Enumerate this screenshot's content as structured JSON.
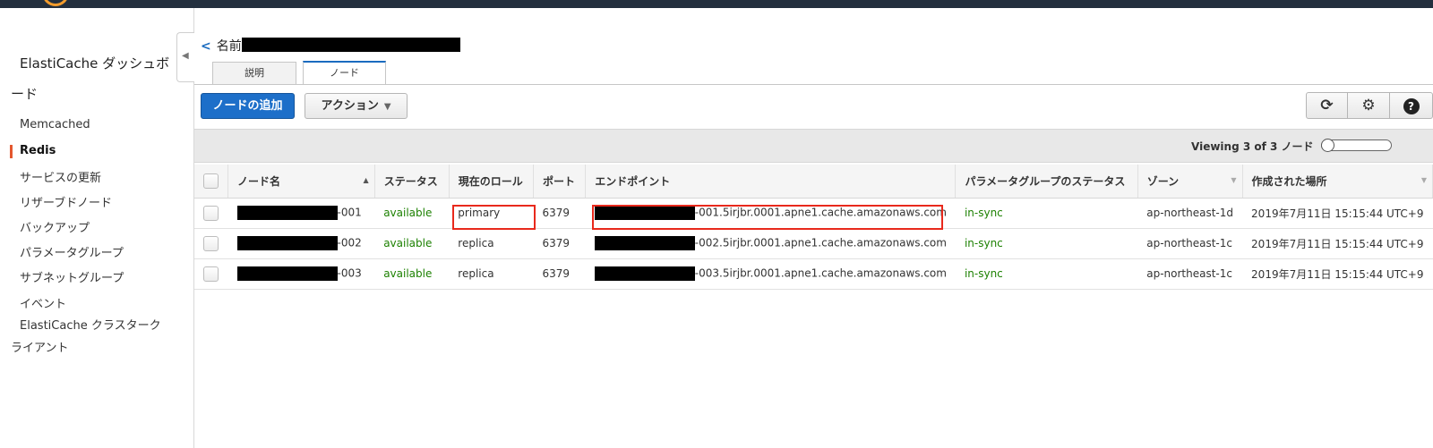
{
  "sidebar": {
    "title": "ElastiCache ダッシュボード",
    "items": [
      {
        "label": "Memcached"
      },
      {
        "label": "Redis"
      },
      {
        "label": "サービスの更新"
      },
      {
        "label": "リザーブドノード"
      },
      {
        "label": "バックアップ"
      },
      {
        "label": "パラメータグループ"
      },
      {
        "label": "サブネットグループ"
      },
      {
        "label": "イベント"
      },
      {
        "label": "ElastiCache クラスタークライアント"
      }
    ],
    "active_item": "Redis"
  },
  "breadcrumb": {
    "back": "<",
    "label": "名前:"
  },
  "tabs": [
    {
      "label": "説明"
    },
    {
      "label": "ノード"
    }
  ],
  "active_tab": "ノード",
  "toolbar": {
    "add_node_label": "ノードの追加",
    "actions_label": "アクション",
    "refresh_icon": "refresh-icon",
    "settings_icon": "gear-icon",
    "help_icon": "help-icon"
  },
  "viewing": {
    "text": "Viewing 3 of 3 ノード"
  },
  "table": {
    "columns": [
      "ノード名",
      "ステータス",
      "現在のロール",
      "ポート",
      "エンドポイント",
      "パラメータグループのステータス",
      "ゾーン",
      "作成された場所"
    ],
    "rows": [
      {
        "name_suffix": "-001",
        "status": "available",
        "role": "primary",
        "port": "6379",
        "endpoint_suffix": "-001.5irjbr.0001.apne1.cache.amazonaws.com",
        "param_status": "in-sync",
        "zone": "ap-northeast-1d",
        "created": "2019年7月11日 15:15:44 UTC+9"
      },
      {
        "name_suffix": "-002",
        "status": "available",
        "role": "replica",
        "port": "6379",
        "endpoint_suffix": "-002.5irjbr.0001.apne1.cache.amazonaws.com",
        "param_status": "in-sync",
        "zone": "ap-northeast-1c",
        "created": "2019年7月11日 15:15:44 UTC+9"
      },
      {
        "name_suffix": "-003",
        "status": "available",
        "role": "replica",
        "port": "6379",
        "endpoint_suffix": "-003.5irjbr.0001.apne1.cache.amazonaws.com",
        "param_status": "in-sync",
        "zone": "ap-northeast-1c",
        "created": "2019年7月11日 15:15:44 UTC+9"
      }
    ]
  },
  "colors": {
    "header": "#232f3e",
    "primary_button": "#1d6fc9",
    "status_green": "#1d8102",
    "highlight": "#e8291c"
  }
}
